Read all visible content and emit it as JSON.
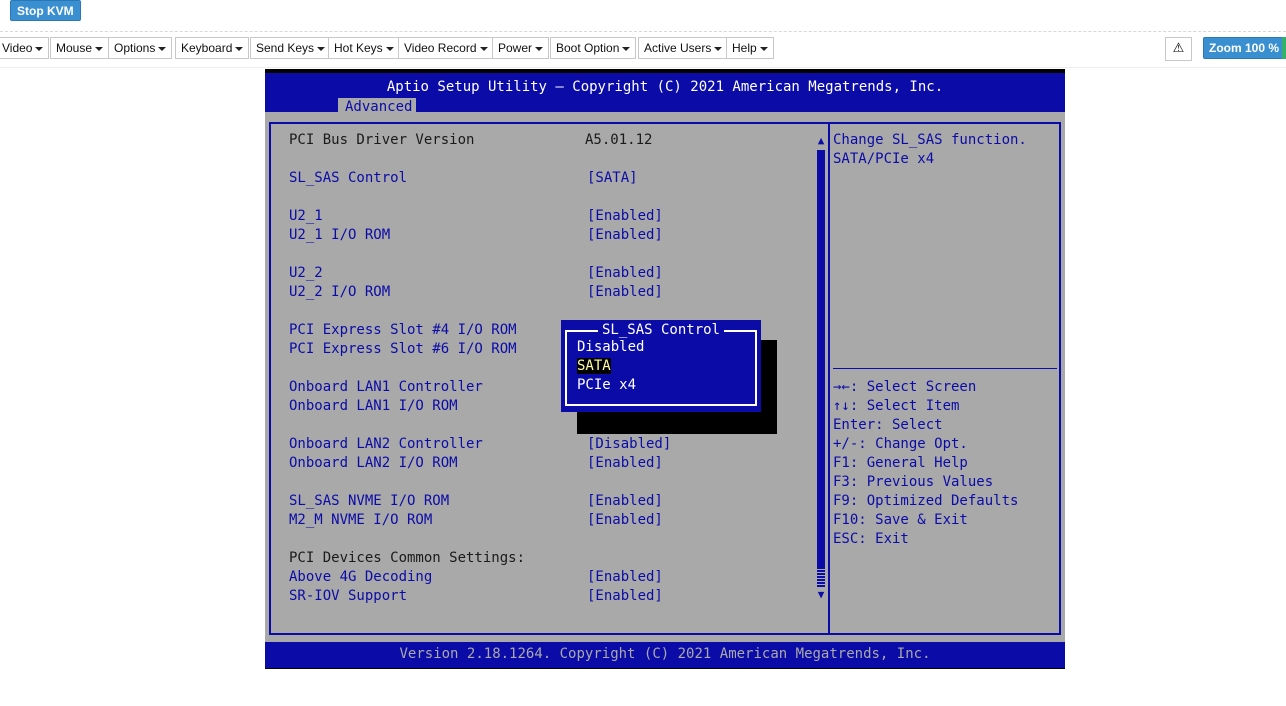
{
  "kvm": {
    "stop_label": "Stop KVM",
    "menus": [
      "Video",
      "Mouse",
      "Options",
      "Keyboard",
      "Send Keys",
      "Hot Keys",
      "Video Record",
      "Power",
      "Boot Option",
      "Active Users",
      "Help"
    ],
    "warning_icon": "warning-icon",
    "zoom_label": "Zoom 100 %"
  },
  "bios": {
    "title": "Aptio Setup Utility – Copyright (C) 2021 American Megatrends, Inc.",
    "tab": "Advanced",
    "settings": [
      {
        "label": "PCI Bus Driver Version",
        "value": "A5.01.12"
      },
      {
        "label": "SL_SAS Control",
        "value": "[SATA]"
      },
      {
        "label": "U2_1",
        "value": "[Enabled]"
      },
      {
        "label": "U2_1 I/O ROM",
        "value": "[Enabled]"
      },
      {
        "label": "U2_2",
        "value": "[Enabled]"
      },
      {
        "label": "U2_2 I/O ROM",
        "value": "[Enabled]"
      },
      {
        "label": "PCI Express Slot #4 I/O ROM",
        "value": ""
      },
      {
        "label": "PCI Express Slot #6 I/O ROM",
        "value": ""
      },
      {
        "label": "Onboard LAN1 Controller",
        "value": ""
      },
      {
        "label": "Onboard LAN1 I/O ROM",
        "value": ""
      },
      {
        "label": "Onboard LAN2 Controller",
        "value": "[Disabled]"
      },
      {
        "label": "Onboard LAN2 I/O ROM",
        "value": "[Enabled]"
      },
      {
        "label": "SL_SAS NVME I/O ROM",
        "value": "[Enabled]"
      },
      {
        "label": "M2_M NVME I/O ROM",
        "value": "[Enabled]"
      },
      {
        "label": "PCI Devices Common Settings:",
        "value": ""
      },
      {
        "label": "Above 4G Decoding",
        "value": "[Enabled]"
      },
      {
        "label": "SR-IOV Support",
        "value": "[Enabled]"
      }
    ],
    "scroll_up": "▲",
    "scroll_down": "▼",
    "help_text": [
      "Change SL_SAS function.",
      "SATA/PCIe x4"
    ],
    "key_help": [
      "→←: Select Screen",
      "↑↓: Select Item",
      "Enter: Select",
      "+/-: Change Opt.",
      "F1: General Help",
      "F3: Previous Values",
      "F9: Optimized Defaults",
      "F10: Save & Exit",
      "ESC: Exit"
    ],
    "popup": {
      "title": "SL_SAS Control",
      "options": [
        "Disabled",
        "SATA",
        "PCIe x4"
      ],
      "selected": "SATA"
    },
    "footer": "Version 2.18.1264. Copyright (C) 2021 American Megatrends, Inc.",
    "colors": {
      "blue": "#0b0ba8",
      "gray": "#a9a9a9",
      "highlight_text": "#ffffa0"
    }
  }
}
